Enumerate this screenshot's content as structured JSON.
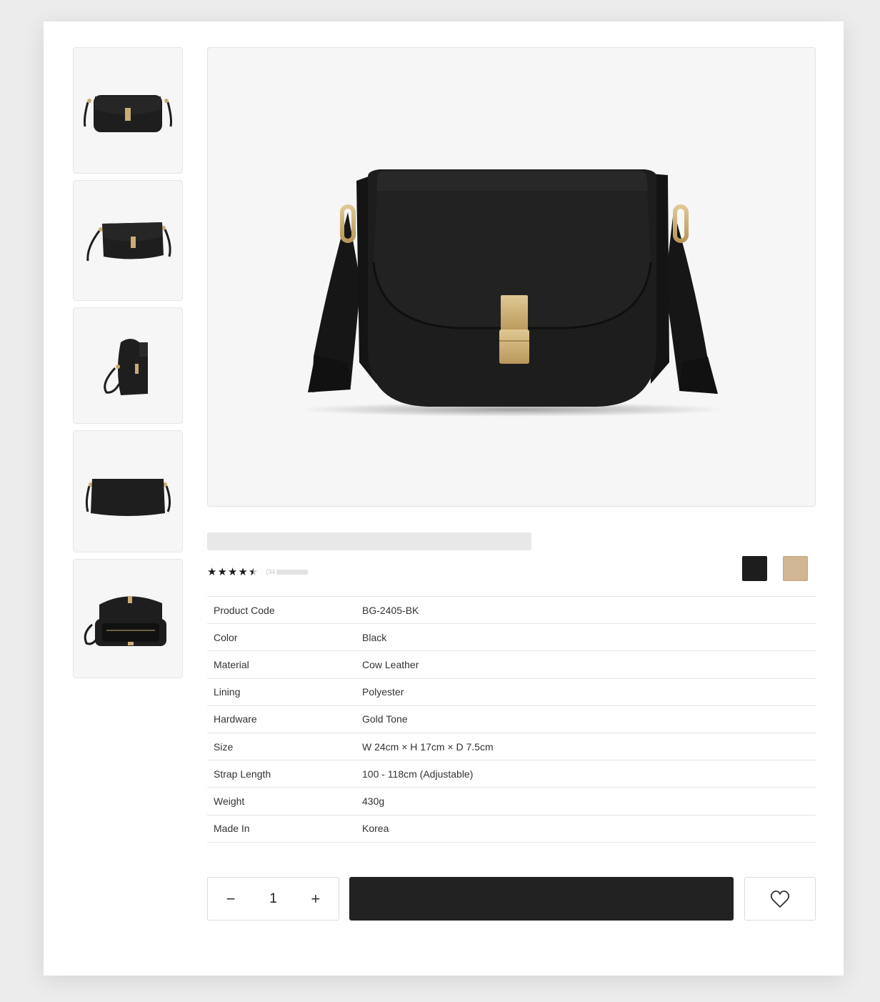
{
  "product": {
    "rating": {
      "value": 4.5,
      "max": 5,
      "stars": [
        "★",
        "★",
        "★",
        "★",
        "★"
      ],
      "count_prefix": "(34"
    },
    "colors": {
      "swatches": [
        {
          "name": "black-swatch",
          "hex": "#1d1d1d"
        },
        {
          "name": "beige-swatch",
          "hex": "#d2b593"
        }
      ]
    },
    "thumbnails": [
      {
        "name": "thumbnail-front"
      },
      {
        "name": "thumbnail-angle"
      },
      {
        "name": "thumbnail-side"
      },
      {
        "name": "thumbnail-back"
      },
      {
        "name": "thumbnail-open"
      }
    ],
    "specs": [
      {
        "label": "Product Code",
        "value": "BG-2405-BK"
      },
      {
        "label": "Color",
        "value": "Black"
      },
      {
        "label": "Material",
        "value": "Cow Leather"
      },
      {
        "label": "Lining",
        "value": "Polyester"
      },
      {
        "label": "Hardware",
        "value": "Gold Tone"
      },
      {
        "label": "Size",
        "value": "W 24cm × H 17cm × D 7.5cm"
      },
      {
        "label": "Strap Length",
        "value": "100 - 118cm (Adjustable)"
      },
      {
        "label": "Weight",
        "value": "430g"
      },
      {
        "label": "Made In",
        "value": "Korea"
      }
    ]
  },
  "purchase": {
    "minus_label": "−",
    "quantity": "1",
    "plus_label": "+",
    "wishlist_icon": "heart-icon"
  },
  "colors": {
    "bag": "#1e1e1e",
    "hardware": "#c9ad74",
    "accent": "#222222"
  }
}
